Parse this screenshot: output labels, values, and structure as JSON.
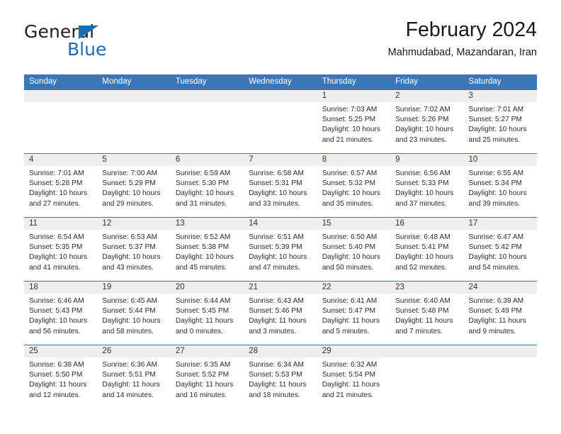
{
  "brand": {
    "name_part1": "General",
    "name_part2": "Blue",
    "logo_icon": "triangle-flag-icon"
  },
  "header": {
    "title": "February 2024",
    "subtitle": "Mahmudabad, Mazandaran, Iran"
  },
  "colors": {
    "header_blue": "#3b77b8",
    "brand_blue": "#1b6cb3",
    "daynum_gray": "#eeeeee"
  },
  "weekday_headers": [
    "Sunday",
    "Monday",
    "Tuesday",
    "Wednesday",
    "Thursday",
    "Friday",
    "Saturday"
  ],
  "labels": {
    "sunrise_prefix": "Sunrise:",
    "sunset_prefix": "Sunset:",
    "daylight_prefix": "Daylight:"
  },
  "weeks": [
    [
      {
        "day": "",
        "line1": "",
        "line2": "",
        "line3": "",
        "line4": ""
      },
      {
        "day": "",
        "line1": "",
        "line2": "",
        "line3": "",
        "line4": ""
      },
      {
        "day": "",
        "line1": "",
        "line2": "",
        "line3": "",
        "line4": ""
      },
      {
        "day": "",
        "line1": "",
        "line2": "",
        "line3": "",
        "line4": ""
      },
      {
        "day": "1",
        "line1": "Sunrise: 7:03 AM",
        "line2": "Sunset: 5:25 PM",
        "line3": "Daylight: 10 hours",
        "line4": "and 21 minutes."
      },
      {
        "day": "2",
        "line1": "Sunrise: 7:02 AM",
        "line2": "Sunset: 5:26 PM",
        "line3": "Daylight: 10 hours",
        "line4": "and 23 minutes."
      },
      {
        "day": "3",
        "line1": "Sunrise: 7:01 AM",
        "line2": "Sunset: 5:27 PM",
        "line3": "Daylight: 10 hours",
        "line4": "and 25 minutes."
      }
    ],
    [
      {
        "day": "4",
        "line1": "Sunrise: 7:01 AM",
        "line2": "Sunset: 5:28 PM",
        "line3": "Daylight: 10 hours",
        "line4": "and 27 minutes."
      },
      {
        "day": "5",
        "line1": "Sunrise: 7:00 AM",
        "line2": "Sunset: 5:29 PM",
        "line3": "Daylight: 10 hours",
        "line4": "and 29 minutes."
      },
      {
        "day": "6",
        "line1": "Sunrise: 6:59 AM",
        "line2": "Sunset: 5:30 PM",
        "line3": "Daylight: 10 hours",
        "line4": "and 31 minutes."
      },
      {
        "day": "7",
        "line1": "Sunrise: 6:58 AM",
        "line2": "Sunset: 5:31 PM",
        "line3": "Daylight: 10 hours",
        "line4": "and 33 minutes."
      },
      {
        "day": "8",
        "line1": "Sunrise: 6:57 AM",
        "line2": "Sunset: 5:32 PM",
        "line3": "Daylight: 10 hours",
        "line4": "and 35 minutes."
      },
      {
        "day": "9",
        "line1": "Sunrise: 6:56 AM",
        "line2": "Sunset: 5:33 PM",
        "line3": "Daylight: 10 hours",
        "line4": "and 37 minutes."
      },
      {
        "day": "10",
        "line1": "Sunrise: 6:55 AM",
        "line2": "Sunset: 5:34 PM",
        "line3": "Daylight: 10 hours",
        "line4": "and 39 minutes."
      }
    ],
    [
      {
        "day": "11",
        "line1": "Sunrise: 6:54 AM",
        "line2": "Sunset: 5:35 PM",
        "line3": "Daylight: 10 hours",
        "line4": "and 41 minutes."
      },
      {
        "day": "12",
        "line1": "Sunrise: 6:53 AM",
        "line2": "Sunset: 5:37 PM",
        "line3": "Daylight: 10 hours",
        "line4": "and 43 minutes."
      },
      {
        "day": "13",
        "line1": "Sunrise: 6:52 AM",
        "line2": "Sunset: 5:38 PM",
        "line3": "Daylight: 10 hours",
        "line4": "and 45 minutes."
      },
      {
        "day": "14",
        "line1": "Sunrise: 6:51 AM",
        "line2": "Sunset: 5:39 PM",
        "line3": "Daylight: 10 hours",
        "line4": "and 47 minutes."
      },
      {
        "day": "15",
        "line1": "Sunrise: 6:50 AM",
        "line2": "Sunset: 5:40 PM",
        "line3": "Daylight: 10 hours",
        "line4": "and 50 minutes."
      },
      {
        "day": "16",
        "line1": "Sunrise: 6:48 AM",
        "line2": "Sunset: 5:41 PM",
        "line3": "Daylight: 10 hours",
        "line4": "and 52 minutes."
      },
      {
        "day": "17",
        "line1": "Sunrise: 6:47 AM",
        "line2": "Sunset: 5:42 PM",
        "line3": "Daylight: 10 hours",
        "line4": "and 54 minutes."
      }
    ],
    [
      {
        "day": "18",
        "line1": "Sunrise: 6:46 AM",
        "line2": "Sunset: 5:43 PM",
        "line3": "Daylight: 10 hours",
        "line4": "and 56 minutes."
      },
      {
        "day": "19",
        "line1": "Sunrise: 6:45 AM",
        "line2": "Sunset: 5:44 PM",
        "line3": "Daylight: 10 hours",
        "line4": "and 58 minutes."
      },
      {
        "day": "20",
        "line1": "Sunrise: 6:44 AM",
        "line2": "Sunset: 5:45 PM",
        "line3": "Daylight: 11 hours",
        "line4": "and 0 minutes."
      },
      {
        "day": "21",
        "line1": "Sunrise: 6:43 AM",
        "line2": "Sunset: 5:46 PM",
        "line3": "Daylight: 11 hours",
        "line4": "and 3 minutes."
      },
      {
        "day": "22",
        "line1": "Sunrise: 6:41 AM",
        "line2": "Sunset: 5:47 PM",
        "line3": "Daylight: 11 hours",
        "line4": "and 5 minutes."
      },
      {
        "day": "23",
        "line1": "Sunrise: 6:40 AM",
        "line2": "Sunset: 5:48 PM",
        "line3": "Daylight: 11 hours",
        "line4": "and 7 minutes."
      },
      {
        "day": "24",
        "line1": "Sunrise: 6:39 AM",
        "line2": "Sunset: 5:49 PM",
        "line3": "Daylight: 11 hours",
        "line4": "and 9 minutes."
      }
    ],
    [
      {
        "day": "25",
        "line1": "Sunrise: 6:38 AM",
        "line2": "Sunset: 5:50 PM",
        "line3": "Daylight: 11 hours",
        "line4": "and 12 minutes."
      },
      {
        "day": "26",
        "line1": "Sunrise: 6:36 AM",
        "line2": "Sunset: 5:51 PM",
        "line3": "Daylight: 11 hours",
        "line4": "and 14 minutes."
      },
      {
        "day": "27",
        "line1": "Sunrise: 6:35 AM",
        "line2": "Sunset: 5:52 PM",
        "line3": "Daylight: 11 hours",
        "line4": "and 16 minutes."
      },
      {
        "day": "28",
        "line1": "Sunrise: 6:34 AM",
        "line2": "Sunset: 5:53 PM",
        "line3": "Daylight: 11 hours",
        "line4": "and 18 minutes."
      },
      {
        "day": "29",
        "line1": "Sunrise: 6:32 AM",
        "line2": "Sunset: 5:54 PM",
        "line3": "Daylight: 11 hours",
        "line4": "and 21 minutes."
      },
      {
        "day": "",
        "line1": "",
        "line2": "",
        "line3": "",
        "line4": ""
      },
      {
        "day": "",
        "line1": "",
        "line2": "",
        "line3": "",
        "line4": ""
      }
    ]
  ]
}
